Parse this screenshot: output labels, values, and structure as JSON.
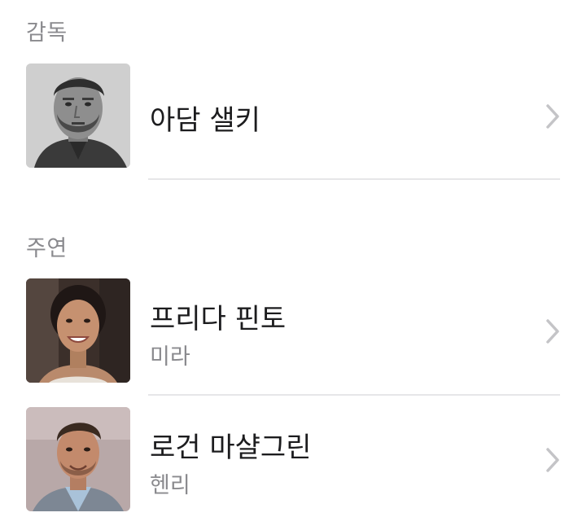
{
  "director_section": {
    "header": "감독",
    "people": [
      {
        "name": "아담 샐키",
        "role": "",
        "avatar": "director-portrait"
      }
    ]
  },
  "cast_section": {
    "header": "주연",
    "people": [
      {
        "name": "프리다 핀토",
        "role": "미라",
        "avatar": "actress-portrait"
      },
      {
        "name": "로건 마샬그린",
        "role": "헨리",
        "avatar": "actor-portrait"
      }
    ]
  },
  "icons": {
    "row_disclosure": "chevron-right-icon"
  },
  "colors": {
    "secondary_text": "#8a8a8e",
    "primary_text": "#1c1c1e",
    "chevron": "#c4c4c7",
    "separator": "#e6e6e8"
  }
}
